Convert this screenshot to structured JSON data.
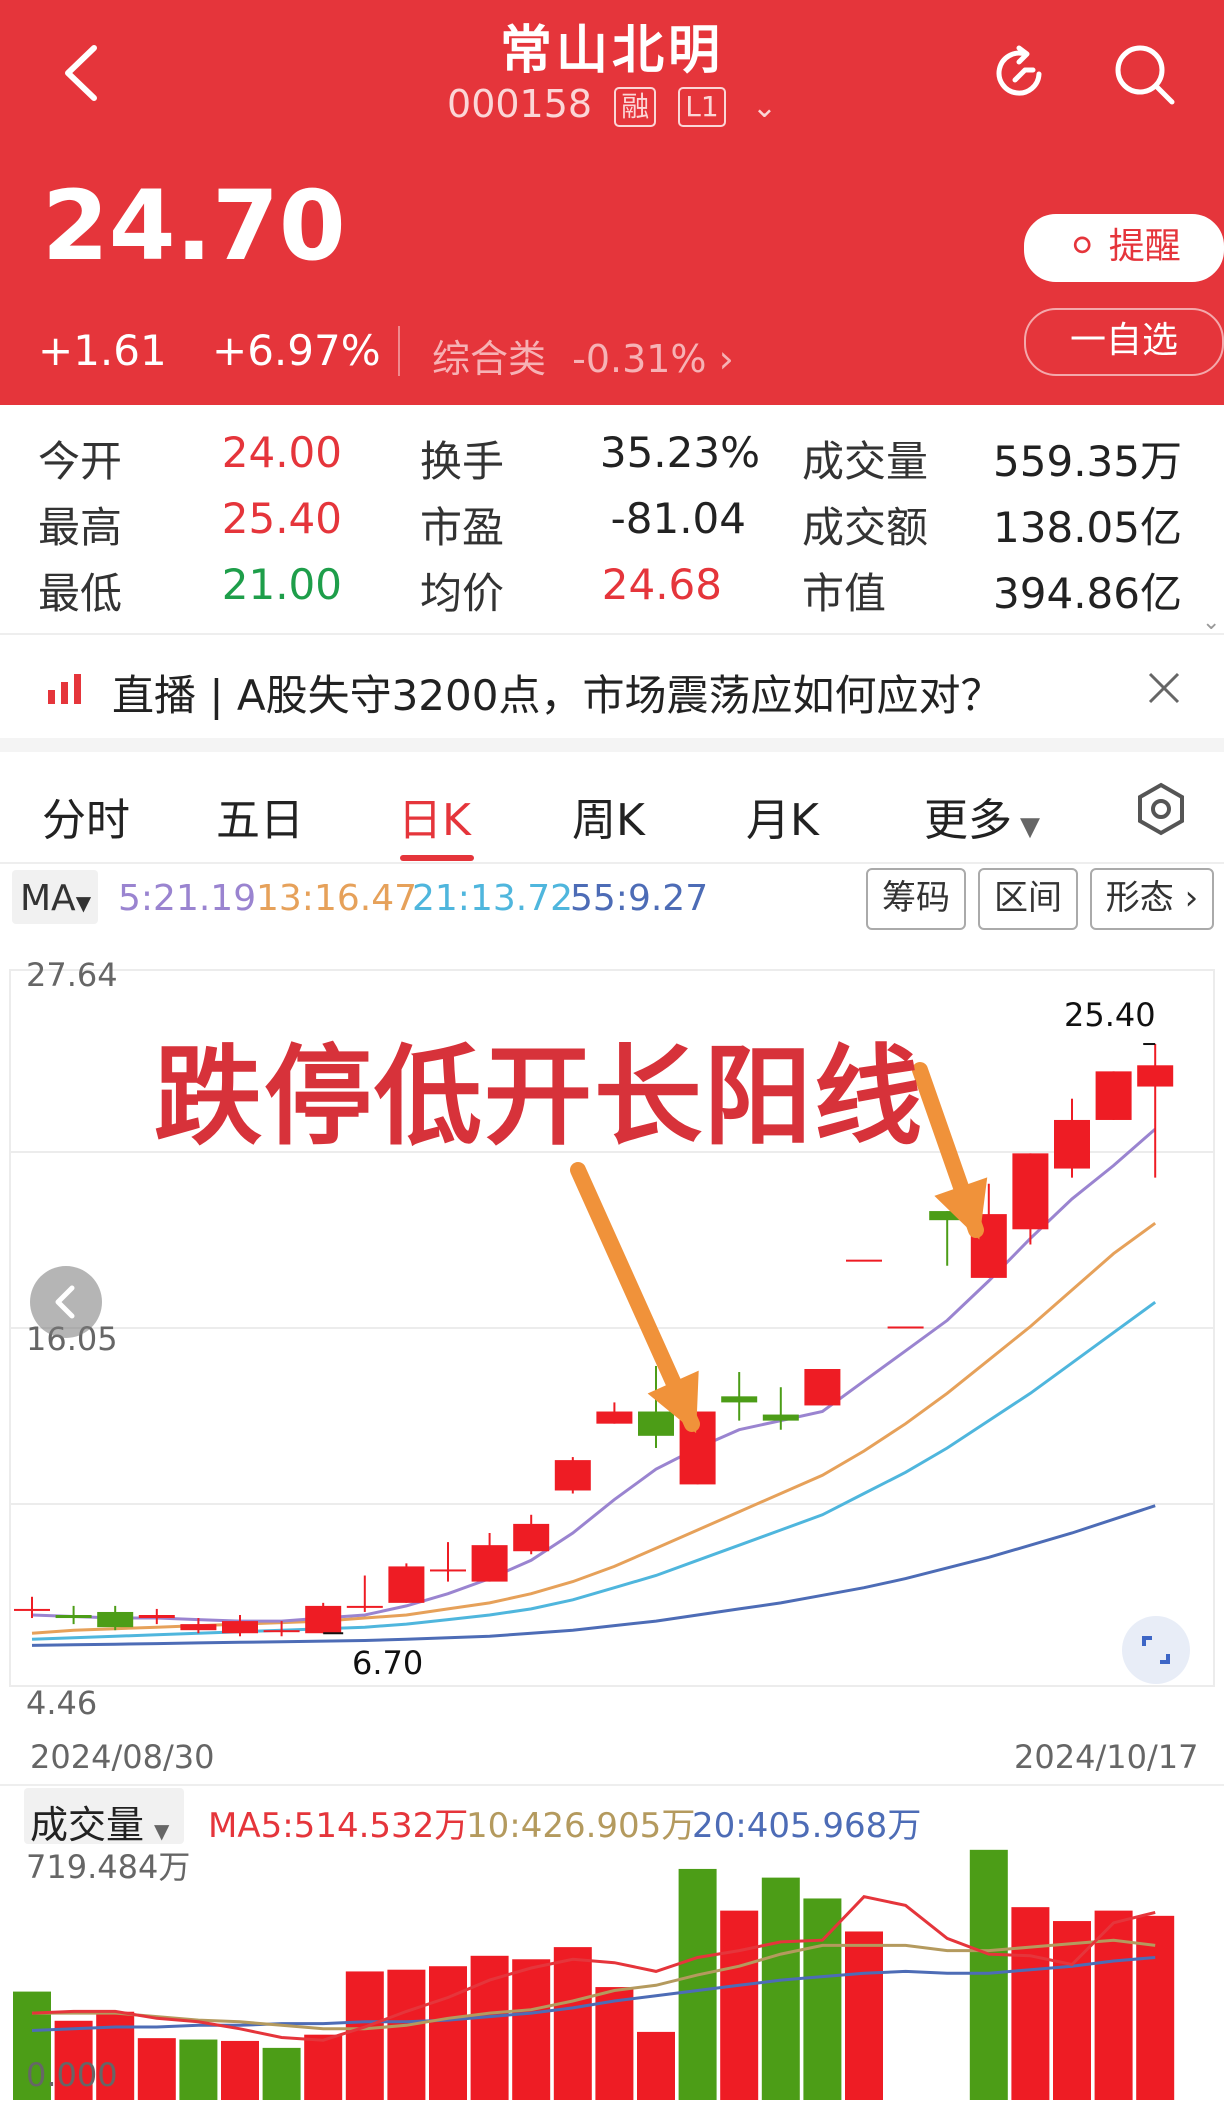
{
  "header": {
    "stock_name": "常山北明",
    "stock_code": "000158",
    "tag_margin": "融",
    "tag_level": "L1",
    "price": "24.70",
    "change": "+1.61",
    "change_pct": "+6.97%",
    "sector": "综合类",
    "sector_pct": "-0.31%",
    "remind_label": "提醒",
    "watchlist_label": "一自选"
  },
  "stats": {
    "open_label": "今开",
    "open": "24.00",
    "high_label": "最高",
    "high": "25.40",
    "low_label": "最低",
    "low": "21.00",
    "turnover_label": "换手",
    "turnover": "35.23%",
    "pe_label": "市盈",
    "pe": "-81.04",
    "avg_label": "均价",
    "avg": "24.68",
    "volume_label": "成交量",
    "volume": "559.35万",
    "amount_label": "成交额",
    "amount": "138.05亿",
    "mcap_label": "市值",
    "mcap": "394.86亿"
  },
  "news": {
    "text": "直播 | A股失守3200点，市场震荡应如何应对？"
  },
  "tabs": [
    "分时",
    "五日",
    "日K",
    "周K",
    "月K",
    "更多"
  ],
  "ma": {
    "label": "MA",
    "ma5": "5:21.19",
    "ma13": "13:16.47",
    "ma21": "21:13.72",
    "ma55": "55:9.27",
    "buttons": [
      "筹码",
      "区间",
      "形态"
    ]
  },
  "colors": {
    "up": "#ee1c24",
    "down": "#4c9d17",
    "ma5": "#9a84d0",
    "ma13": "#e6a15a",
    "ma21": "#4fb6dd",
    "ma55": "#4d6cb6",
    "arrow": "#f0923a"
  },
  "chart_data": [
    {
      "type": "candlestick",
      "title": "",
      "annotation": "跌停低开长阳线",
      "y_top_label": "27.64",
      "y_mid_label": "16.05",
      "y_bottom_label": "4.46",
      "ylim": [
        4.46,
        27.64
      ],
      "x_start": "2024/08/30",
      "x_end": "2024/10/17",
      "high_marker": "25.40",
      "low_marker": "6.70",
      "candles": [
        {
          "o": 6.8,
          "c": 6.8,
          "h": 7.2,
          "l": 6.5
        },
        {
          "o": 6.6,
          "c": 6.5,
          "h": 6.9,
          "l": 6.3
        },
        {
          "o": 6.7,
          "c": 6.2,
          "h": 6.9,
          "l": 6.1
        },
        {
          "o": 6.5,
          "c": 6.6,
          "h": 6.8,
          "l": 6.3
        },
        {
          "o": 6.1,
          "c": 6.3,
          "h": 6.5,
          "l": 6.0
        },
        {
          "o": 6.0,
          "c": 6.4,
          "h": 6.6,
          "l": 5.9
        },
        {
          "o": 6.1,
          "c": 6.1,
          "h": 6.4,
          "l": 5.9
        },
        {
          "o": 6.0,
          "c": 6.9,
          "h": 7.0,
          "l": 6.0
        },
        {
          "o": 6.9,
          "c": 6.9,
          "h": 7.9,
          "l": 6.7
        },
        {
          "o": 7.0,
          "c": 8.2,
          "h": 8.3,
          "l": 7.0
        },
        {
          "o": 8.1,
          "c": 8.1,
          "h": 9.0,
          "l": 7.7
        },
        {
          "o": 7.7,
          "c": 8.9,
          "h": 9.3,
          "l": 7.7
        },
        {
          "o": 8.7,
          "c": 9.6,
          "h": 9.9,
          "l": 8.6
        },
        {
          "o": 10.7,
          "c": 11.7,
          "h": 11.8,
          "l": 10.6
        },
        {
          "o": 12.9,
          "c": 13.3,
          "h": 13.6,
          "l": 12.9
        },
        {
          "o": 13.3,
          "c": 12.5,
          "h": 14.8,
          "l": 12.1
        },
        {
          "o": 10.9,
          "c": 13.3,
          "h": 13.3,
          "l": 10.9
        },
        {
          "o": 13.8,
          "c": 13.6,
          "h": 14.6,
          "l": 13.0
        },
        {
          "o": 13.2,
          "c": 13.0,
          "h": 14.1,
          "l": 12.7
        },
        {
          "o": 13.5,
          "c": 14.7,
          "h": 14.7,
          "l": 13.5
        },
        {
          "o": 18.3,
          "c": 18.3,
          "h": 18.3,
          "l": 18.3
        },
        {
          "o": 16.1,
          "c": 16.1,
          "h": 16.1,
          "l": 16.1
        },
        {
          "o": 19.9,
          "c": 19.6,
          "h": 19.9,
          "l": 18.1
        },
        {
          "o": 17.7,
          "c": 19.8,
          "h": 20.8,
          "l": 17.7
        },
        {
          "o": 19.3,
          "c": 21.8,
          "h": 21.8,
          "l": 18.8
        },
        {
          "o": 21.3,
          "c": 22.9,
          "h": 23.6,
          "l": 21.0
        },
        {
          "o": 22.9,
          "c": 24.5,
          "h": 24.5,
          "l": 22.9
        },
        {
          "o": 24.0,
          "c": 24.7,
          "h": 25.4,
          "l": 21.0
        }
      ],
      "ma5_points": [
        6.6,
        6.55,
        6.5,
        6.5,
        6.45,
        6.4,
        6.4,
        6.5,
        6.6,
        6.9,
        7.3,
        7.8,
        8.4,
        9.3,
        10.4,
        11.4,
        12.1,
        12.7,
        13.0,
        13.3,
        14.3,
        15.3,
        16.3,
        17.6,
        19.0,
        20.3,
        21.4,
        22.6
      ],
      "ma13_points": [
        6.0,
        6.1,
        6.15,
        6.2,
        6.25,
        6.3,
        6.35,
        6.4,
        6.5,
        6.6,
        6.8,
        7.0,
        7.3,
        7.7,
        8.2,
        8.8,
        9.4,
        10.0,
        10.6,
        11.2,
        12.0,
        12.9,
        13.9,
        15.0,
        16.1,
        17.3,
        18.5,
        19.5
      ],
      "ma21_points": [
        5.8,
        5.85,
        5.9,
        5.95,
        6.0,
        6.05,
        6.1,
        6.15,
        6.2,
        6.3,
        6.45,
        6.6,
        6.8,
        7.1,
        7.5,
        7.9,
        8.4,
        8.9,
        9.4,
        9.9,
        10.6,
        11.3,
        12.1,
        13.0,
        13.9,
        14.9,
        15.9,
        16.9
      ],
      "ma55_points": [
        5.6,
        5.62,
        5.64,
        5.66,
        5.68,
        5.7,
        5.72,
        5.74,
        5.76,
        5.8,
        5.85,
        5.9,
        6.0,
        6.1,
        6.25,
        6.4,
        6.6,
        6.8,
        7.0,
        7.25,
        7.5,
        7.8,
        8.15,
        8.5,
        8.9,
        9.3,
        9.75,
        10.2
      ]
    },
    {
      "type": "bar",
      "title": "成交量",
      "ma5_label": "MA5:514.532万",
      "ma10_label": "10:426.905万",
      "ma20_label": "20:405.968万",
      "y_top_label": "719.484万",
      "y_bottom_label": "0.000",
      "ylim": [
        0,
        719.484
      ],
      "values": [
        312,
        228,
        254,
        178,
        174,
        170,
        150,
        188,
        370,
        375,
        385,
        415,
        405,
        440,
        325,
        196,
        665,
        545,
        640,
        580,
        485,
        0,
        0,
        720,
        555,
        515,
        545,
        530
      ],
      "ma5_points": [
        250,
        255,
        255,
        235,
        225,
        205,
        180,
        172,
        210,
        255,
        295,
        345,
        380,
        405,
        395,
        370,
        410,
        430,
        455,
        460,
        585,
        560,
        465,
        420,
        415,
        390,
        510,
        540
      ],
      "ma10_points": [
        250,
        250,
        250,
        240,
        230,
        225,
        215,
        205,
        205,
        215,
        235,
        250,
        260,
        285,
        315,
        330,
        360,
        385,
        420,
        445,
        445,
        445,
        430,
        430,
        440,
        450,
        460,
        445
      ],
      "ma20_points": [
        200,
        205,
        210,
        210,
        215,
        215,
        220,
        220,
        225,
        225,
        230,
        240,
        250,
        265,
        285,
        300,
        315,
        330,
        345,
        355,
        365,
        370,
        365,
        365,
        375,
        385,
        400,
        410
      ],
      "colors_by_bar": [
        "down",
        "up",
        "up",
        "up",
        "down",
        "up",
        "down",
        "up",
        "up",
        "up",
        "up",
        "up",
        "up",
        "up",
        "up",
        "up",
        "down",
        "up",
        "down",
        "down",
        "up",
        "up",
        "up",
        "down",
        "up",
        "up",
        "up",
        "up"
      ]
    }
  ]
}
